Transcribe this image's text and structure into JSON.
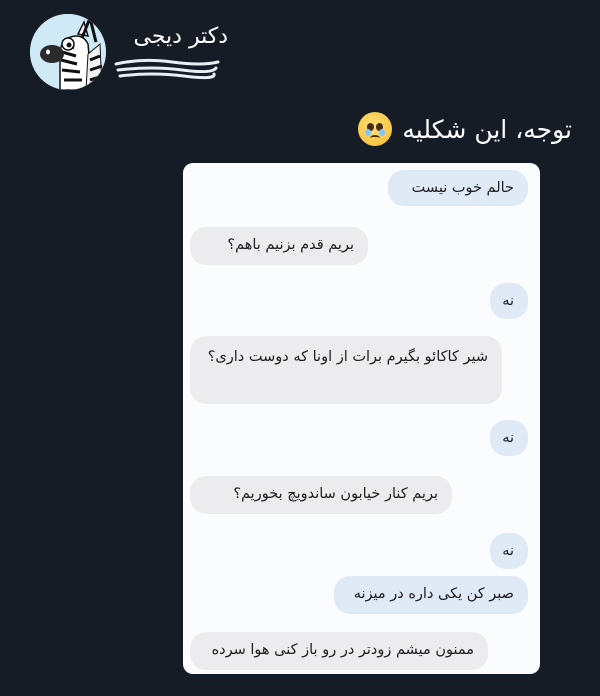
{
  "tweet": {
    "author_name": "دکتر دیجی",
    "text": "توجه، این شکلیه",
    "emoji": "pleading-face-icon"
  },
  "chat": {
    "messages": [
      {
        "side": "sent",
        "text": "حالم خوب نیست"
      },
      {
        "side": "received",
        "text": "بریم قدم بزنیم باهم؟"
      },
      {
        "side": "sent",
        "text": "نه"
      },
      {
        "side": "received",
        "text": "شیر کاکائو بگیرم برات از اونا که دوست داری؟"
      },
      {
        "side": "sent",
        "text": "نه"
      },
      {
        "side": "received",
        "text": "بریم کنار خیابون ساندویچ بخوریم؟"
      },
      {
        "side": "sent",
        "text": "نه"
      },
      {
        "side": "sent",
        "text": "صبر کن یکی داره در میزنه"
      },
      {
        "side": "received",
        "text": "ممنون میشم زودتر در رو باز کنی هوا سرده"
      }
    ]
  },
  "colors": {
    "background": "#161c26",
    "card": "#fbfcfe",
    "sent_bubble": "#dfeaf6",
    "received_bubble": "#ececee"
  }
}
